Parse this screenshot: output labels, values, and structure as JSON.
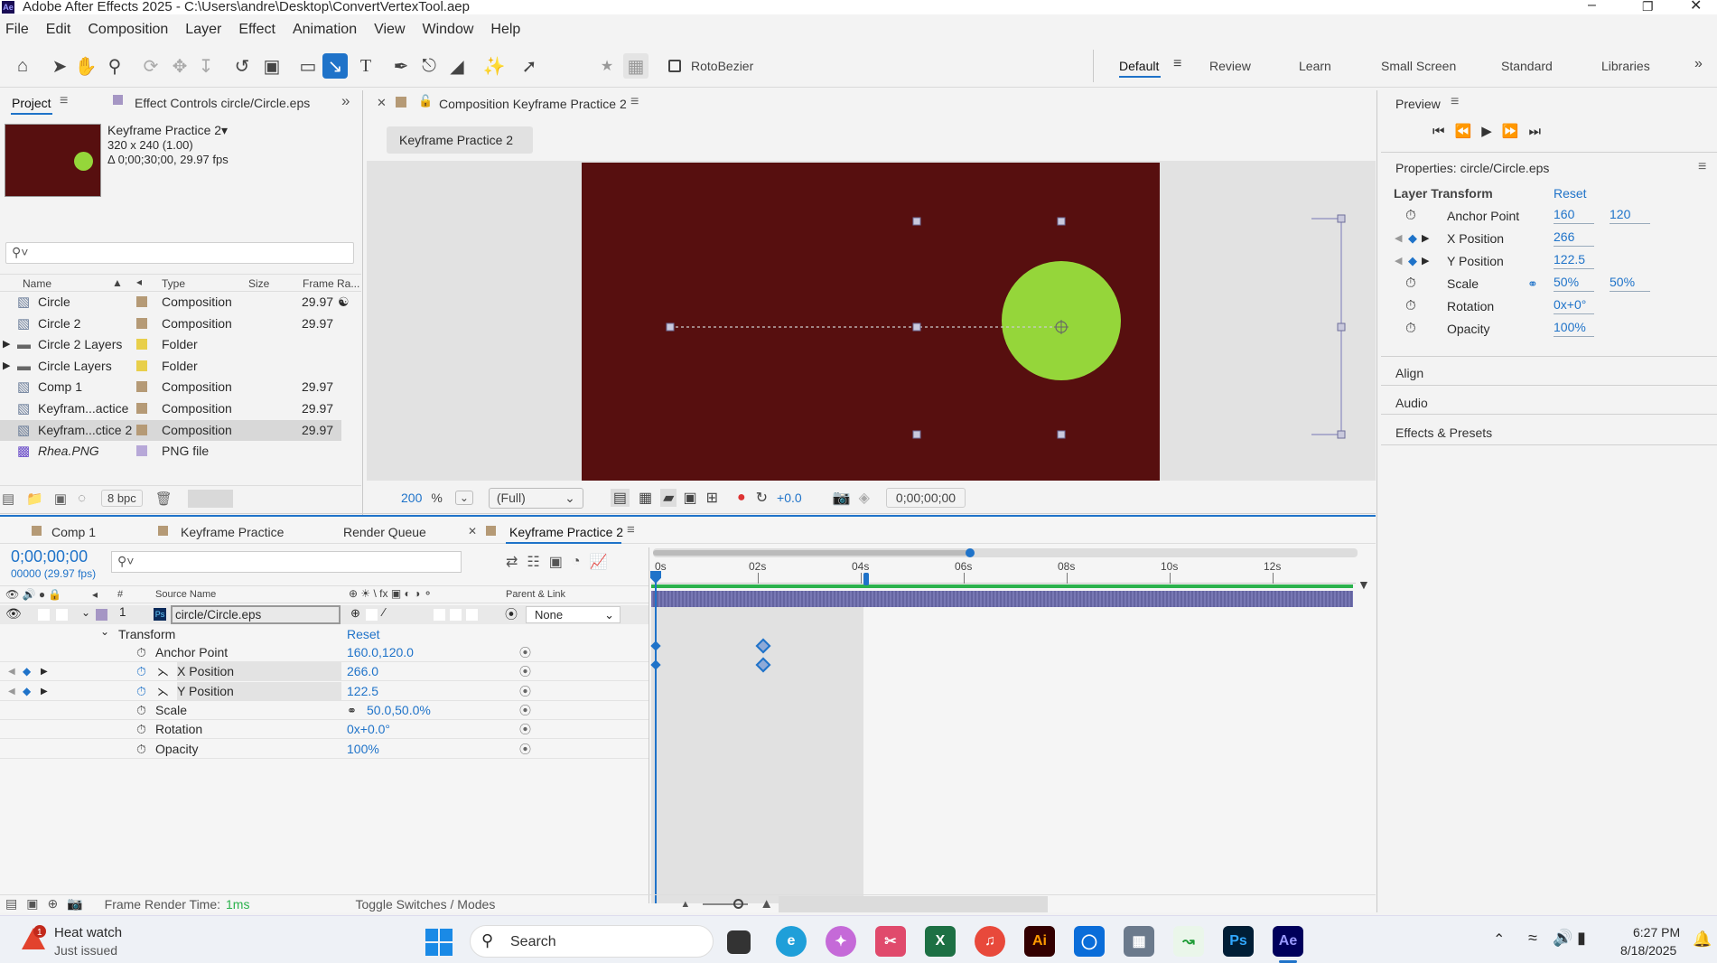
{
  "window": {
    "title": "Adobe After Effects 2025 - C:\\Users\\andre\\Desktop\\ConvertVertexTool.aep",
    "app_icon": "Ae"
  },
  "menu": [
    "File",
    "Edit",
    "Composition",
    "Layer",
    "Effect",
    "Animation",
    "View",
    "Window",
    "Help"
  ],
  "toolbar": {
    "rotobezier_label": "RotoBezier"
  },
  "workspaces": [
    "Default",
    "Review",
    "Learn",
    "Small Screen",
    "Standard",
    "Libraries"
  ],
  "project": {
    "tab_project": "Project",
    "tab_effect_controls": "Effect Controls circle/Circle.eps",
    "comp_name": "Keyframe Practice 2▾",
    "comp_size": "320 x 240 (1.00)",
    "comp_duration": "Δ 0;00;30;00, 29.97 fps",
    "columns": [
      "Name",
      "Type",
      "Size",
      "Frame Ra..."
    ],
    "items": [
      {
        "name": "Circle",
        "type": "Composition",
        "fps": "29.97",
        "color": "#b59a76",
        "icon": "comp"
      },
      {
        "name": "Circle 2",
        "type": "Composition",
        "fps": "29.97",
        "color": "#b59a76",
        "icon": "comp"
      },
      {
        "name": "Circle 2 Layers",
        "type": "Folder",
        "fps": "",
        "color": "#e8cf4a",
        "icon": "folder"
      },
      {
        "name": "Circle Layers",
        "type": "Folder",
        "fps": "",
        "color": "#e8cf4a",
        "icon": "folder"
      },
      {
        "name": "Comp 1",
        "type": "Composition",
        "fps": "29.97",
        "color": "#b59a76",
        "icon": "comp"
      },
      {
        "name": "Keyfram...actice",
        "type": "Composition",
        "fps": "29.97",
        "color": "#b59a76",
        "icon": "comp"
      },
      {
        "name": "Keyfram...ctice 2",
        "type": "Composition",
        "fps": "29.97",
        "color": "#b59a76",
        "icon": "comp"
      },
      {
        "name": "Rhea.PNG",
        "type": "PNG file",
        "fps": "",
        "color": "#b7a8d8",
        "icon": "png"
      }
    ],
    "bpc": "8 bpc"
  },
  "composition": {
    "tab_title": "Composition Keyframe Practice 2",
    "breadcrumb": "Keyframe Practice 2",
    "zoom": "200",
    "zoom_unit": "%",
    "resolution": "(Full)",
    "exposure": "+0.0",
    "timecode": "0;00;00;00",
    "bg_color": "#570f0f",
    "circle_color": "#95d63a"
  },
  "timeline": {
    "tabs": [
      "Comp 1",
      "Keyframe Practice",
      "Render Queue",
      "Keyframe Practice 2"
    ],
    "timecode": "0;00;00;00",
    "frame_info": "00000 (29.97 fps)",
    "col_source": "Source Name",
    "col_parent": "Parent & Link",
    "ruler": [
      "0s",
      "02s",
      "04s",
      "06s",
      "08s",
      "10s",
      "12s"
    ],
    "layer": {
      "num": "1",
      "name": "circle/Circle.eps",
      "parent": "None"
    },
    "transform_label": "Transform",
    "transform_reset": "Reset",
    "props": [
      {
        "name": "Anchor Point",
        "value": "160.0,120.0"
      },
      {
        "name": "X Position",
        "value": "266.0"
      },
      {
        "name": "Y Position",
        "value": "122.5"
      },
      {
        "name": "Scale",
        "value": "50.0,50.0%"
      },
      {
        "name": "Rotation",
        "value": "0x+0.0°"
      },
      {
        "name": "Opacity",
        "value": "100%"
      }
    ],
    "footer_render_label": "Frame Render Time:",
    "footer_render_value": "1ms",
    "footer_toggle": "Toggle Switches / Modes"
  },
  "preview": {
    "title": "Preview"
  },
  "properties": {
    "title": "Properties: circle/Circle.eps",
    "section": "Layer Transform",
    "reset": "Reset",
    "anchor_label": "Anchor Point",
    "anchor_x": "160",
    "anchor_y": "120",
    "xpos_label": "X Position",
    "xpos": "266",
    "ypos_label": "Y Position",
    "ypos": "122.5",
    "scale_label": "Scale",
    "scale_x": "50%",
    "scale_y": "50%",
    "rotation_label": "Rotation",
    "rotation": "0x+0°",
    "opacity_label": "Opacity",
    "opacity": "100%"
  },
  "side_panels": [
    "Align",
    "Audio",
    "Effects & Presets"
  ],
  "taskbar": {
    "notif_title": "Heat watch",
    "notif_sub": "Just issued",
    "search": "Search",
    "time": "6:27 PM",
    "date": "8/18/2025"
  }
}
